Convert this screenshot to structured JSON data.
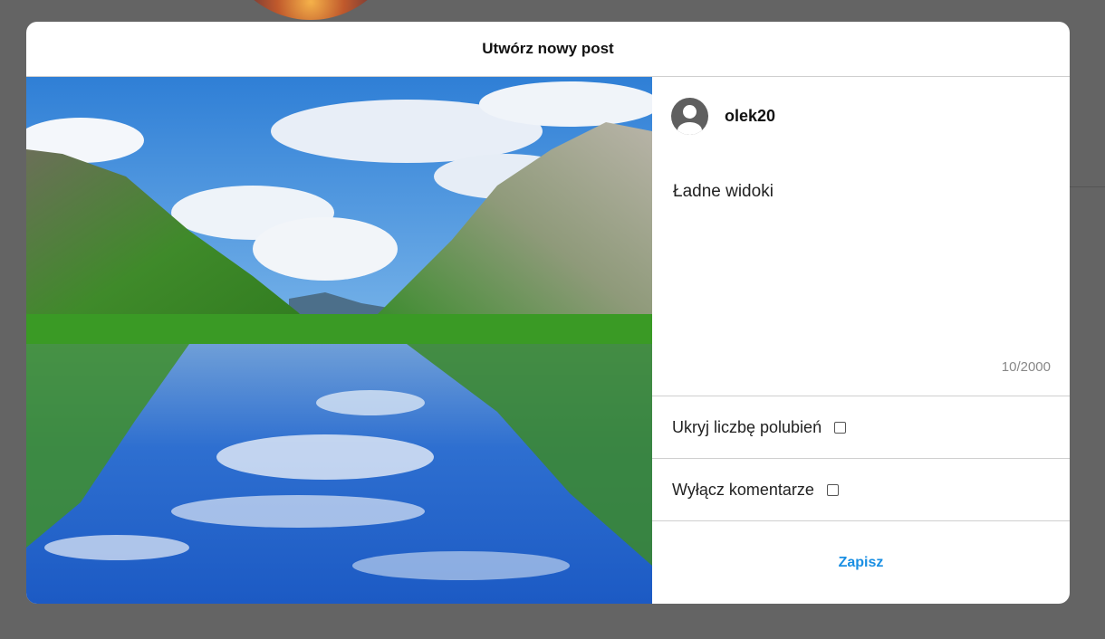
{
  "modal": {
    "title": "Utwórz nowy post"
  },
  "post": {
    "username": "olek20",
    "caption": "Ładne widoki",
    "char_count": "10/2000"
  },
  "options": [
    {
      "label": "Ukryj liczbę polubień",
      "checked": false
    },
    {
      "label": "Wyłącz komentarze",
      "checked": false
    }
  ],
  "actions": {
    "save_label": "Zapisz"
  },
  "colors": {
    "overlay": "#646464",
    "accent": "#1a8fe3"
  },
  "icons": {
    "user_avatar": "user-avatar-icon"
  }
}
